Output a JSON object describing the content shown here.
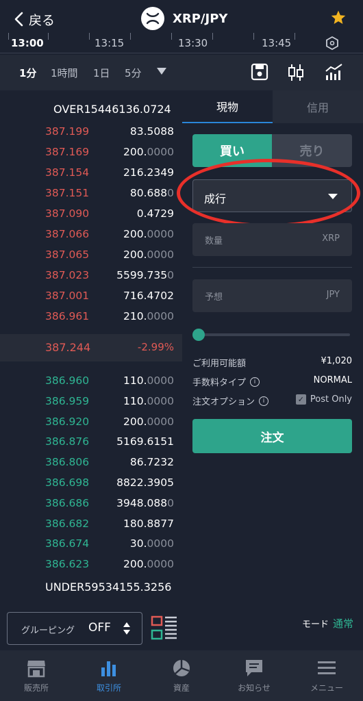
{
  "header": {
    "back_label": "戻る",
    "pair": "XRP/JPY"
  },
  "time_axis": {
    "labels": [
      "13:00",
      "13:15",
      "13:30",
      "13:45"
    ]
  },
  "intervals": {
    "items": [
      "1分",
      "1時間",
      "1日",
      "5分"
    ],
    "active": "1分"
  },
  "order_book": {
    "over": "OVER15446136.0724",
    "asks": [
      {
        "price": "387.199",
        "qty": "83.5088",
        "qty_dim": ""
      },
      {
        "price": "387.169",
        "qty": "200.",
        "qty_dim": "0000"
      },
      {
        "price": "387.154",
        "qty": "216.2349",
        "qty_dim": ""
      },
      {
        "price": "387.151",
        "qty": "80.688",
        "qty_dim": "0"
      },
      {
        "price": "387.090",
        "qty": "0.4729",
        "qty_dim": ""
      },
      {
        "price": "387.066",
        "qty": "200.",
        "qty_dim": "0000"
      },
      {
        "price": "387.065",
        "qty": "200.",
        "qty_dim": "0000"
      },
      {
        "price": "387.023",
        "qty": "5599.735",
        "qty_dim": "0"
      },
      {
        "price": "387.001",
        "qty": "716.4702",
        "qty_dim": ""
      },
      {
        "price": "386.961",
        "qty": "210.",
        "qty_dim": "0000"
      }
    ],
    "mid_price": "387.244",
    "mid_change": "-2.99%",
    "bids": [
      {
        "price": "386.960",
        "qty": "110.",
        "qty_dim": "0000"
      },
      {
        "price": "386.959",
        "qty": "110.",
        "qty_dim": "0000"
      },
      {
        "price": "386.920",
        "qty": "200.",
        "qty_dim": "0000"
      },
      {
        "price": "386.876",
        "qty": "5169.6151",
        "qty_dim": ""
      },
      {
        "price": "386.806",
        "qty": "86.7232",
        "qty_dim": ""
      },
      {
        "price": "386.698",
        "qty": "8822.3905",
        "qty_dim": ""
      },
      {
        "price": "386.686",
        "qty": "3948.088",
        "qty_dim": "0"
      },
      {
        "price": "386.682",
        "qty": "180.8877",
        "qty_dim": ""
      },
      {
        "price": "386.674",
        "qty": "30.",
        "qty_dim": "0000"
      },
      {
        "price": "386.623",
        "qty": "200.",
        "qty_dim": "0000"
      }
    ],
    "under": "UNDER59534155.3256"
  },
  "tabs": {
    "spot": "現物",
    "margin": "信用"
  },
  "trade": {
    "buy": "買い",
    "sell": "売り",
    "order_type": "成行",
    "qty_placeholder": "数量",
    "qty_unit": "XRP",
    "price_placeholder": "予想",
    "price_unit": "JPY",
    "slider_fraction": 0,
    "available_label": "ご利用可能額",
    "available_value": "¥1,020",
    "fee_label": "手数料タイプ",
    "fee_value": "NORMAL",
    "option_label": "注文オプション",
    "post_only": "Post Only",
    "order_button": "注文"
  },
  "bottom": {
    "grouping_label": "グルーピング",
    "grouping_value": "OFF",
    "mode_label": "モード",
    "mode_value": "通常"
  },
  "nav": {
    "items": [
      "販売所",
      "取引所",
      "資産",
      "お知らせ",
      "メニュー"
    ],
    "active": "取引所"
  },
  "colors": {
    "accent_green": "#2ea48b",
    "ask_red": "#e05a55",
    "bid_green": "#2fb693",
    "highlight": "#e8302a"
  }
}
